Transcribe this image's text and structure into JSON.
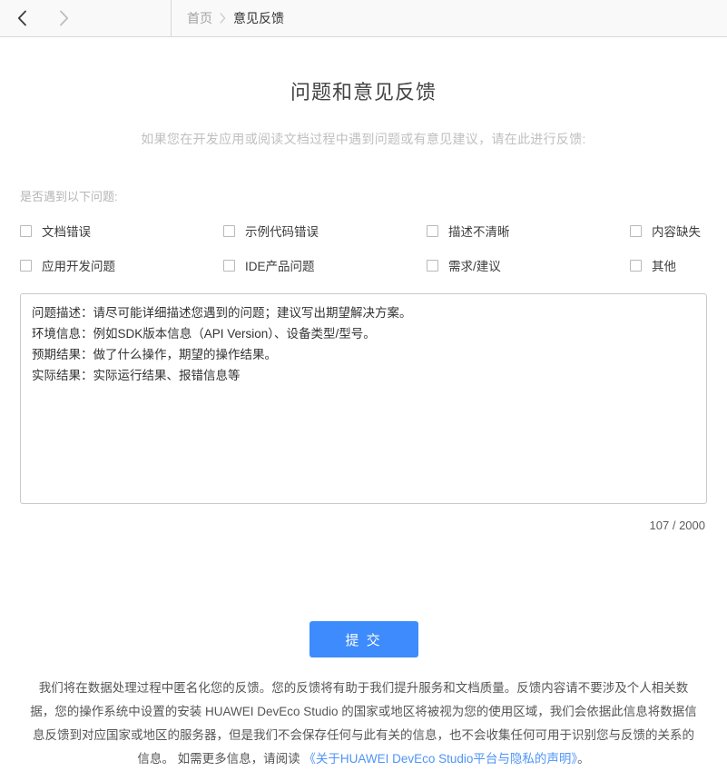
{
  "topbar": {
    "back_icon": "chevron-left-icon",
    "forward_icon": "chevron-right-icon",
    "breadcrumb": {
      "home": "首页",
      "separator": "›",
      "current": "意见反馈"
    }
  },
  "page": {
    "title": "问题和意见反馈",
    "description": "如果您在开发应用或阅读文档过程中遇到问题或有意见建议，请在此进行反馈:"
  },
  "checkbox_section": {
    "label": "是否遇到以下问题:",
    "items": [
      {
        "label": "文档错误",
        "checked": false
      },
      {
        "label": "示例代码错误",
        "checked": false
      },
      {
        "label": "描述不清晰",
        "checked": false
      },
      {
        "label": "内容缺失",
        "checked": false
      },
      {
        "label": "应用开发问题",
        "checked": false
      },
      {
        "label": "IDE产品问题",
        "checked": false
      },
      {
        "label": "需求/建议",
        "checked": false
      },
      {
        "label": "其他",
        "checked": false
      }
    ]
  },
  "feedback": {
    "value": "问题描述：请尽可能详细描述您遇到的问题；建议写出期望解决方案。\n环境信息：例如SDK版本信息（API Version）、设备类型/型号。\n预期结果：做了什么操作，期望的操作结果。\n实际结果：实际运行结果、报错信息等",
    "placeholder": "问题描述：请尽可能详细描述您遇到的问题；建议写出期望解决方案。",
    "char_count": "107 / 2000",
    "current_chars": 107,
    "max_chars": 2000
  },
  "submit": {
    "label": "提 交",
    "color": "#3d8bfd"
  },
  "privacy": {
    "text_before_link": "我们将在数据处理过程中匿名化您的反馈。您的反馈将有助于我们提升服务和文档质量。反馈内容请不要涉及个人相关数据，您的操作系统中设置的安装 HUAWEI DevEco Studio 的国家或地区将被视为您的使用区域，我们会依据此信息将数据信息反馈到对应国家或地区的服务器，但是我们不会保存任何与此有关的信息，也不会收集任何可用于识别您与反馈的关系的信息。 如需更多信息，请阅读",
    "link_text": "《关于HUAWEI DevEco Studio平台与隐私的声明》",
    "text_after_link": "。",
    "link_color": "#4e94f7"
  }
}
